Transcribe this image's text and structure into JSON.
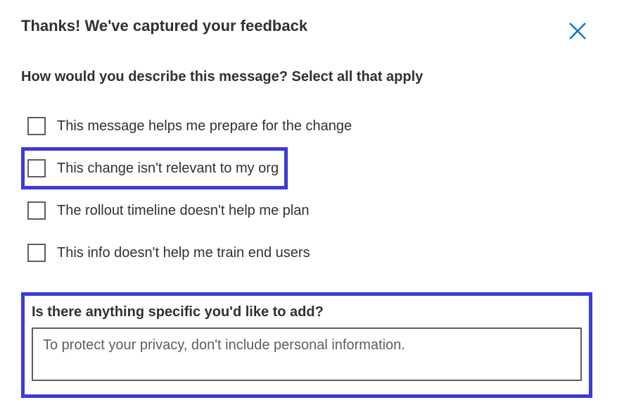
{
  "title": "Thanks! We've captured your feedback",
  "question": "How would you describe this message? Select all that apply",
  "options": [
    {
      "label": "This message helps me prepare for the change",
      "highlight": false,
      "checked": false
    },
    {
      "label": "This change isn't relevant to my org",
      "highlight": true,
      "checked": false
    },
    {
      "label": "The rollout timeline doesn't help me plan",
      "highlight": false,
      "checked": false
    },
    {
      "label": "This info doesn't help me train end users",
      "highlight": false,
      "checked": false
    }
  ],
  "textarea": {
    "question": "Is there anything specific you'd like to add?",
    "placeholder": "To protect your privacy, don't include personal information.",
    "value": ""
  },
  "colors": {
    "highlight": "#3b3bd6",
    "close": "#0078d4"
  }
}
